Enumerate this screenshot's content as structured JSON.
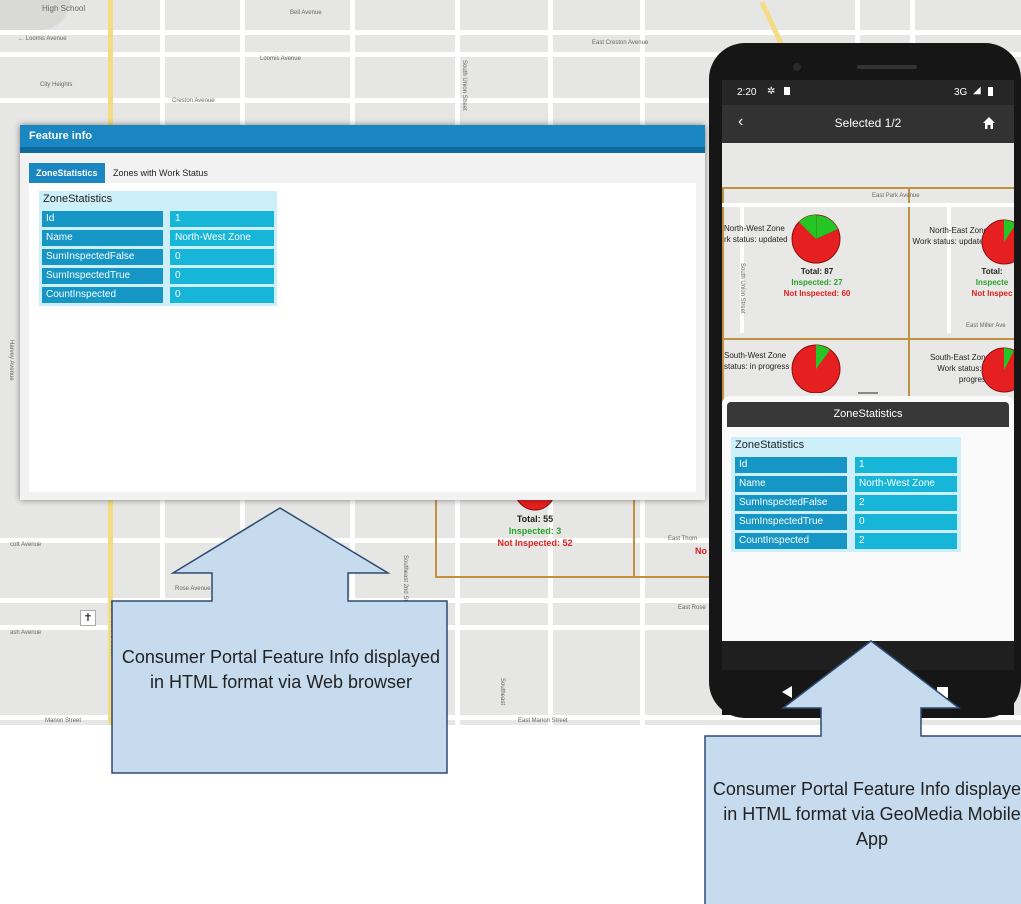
{
  "map": {
    "streets": {
      "loomis_avenue_w": "← Loomis Avenue",
      "bell_avenue": "Bell Avenue",
      "loomis_avenue": "Loomis Avenue",
      "east_creston_avenue": "East Creston Avenue",
      "city_heights": "City Heights",
      "creston_avenue": "Creston Avenue",
      "high_school": "High School",
      "south_union_street": "South Union Street",
      "rose_avenue": "Rose Avenue",
      "east_rose": "East Rose",
      "manon_street": "Manon Street",
      "east_manon_street": "East Manon Street",
      "east_thorn": "East Thorn",
      "cott_avenue": "cott Avenue",
      "ash_avenue": "ash Avenue",
      "southeast_2nd_street": "Southeast 2nd Street",
      "southwest_3rd_street": "Southwest 3rd Street",
      "southeast": "Southeast",
      "harvey_avenue": "Harvey Avenue"
    },
    "zone_label": {
      "total": "Total: 55",
      "inspected": "Inspected: 3",
      "not_inspected": "Not Inspected: 52",
      "clipped_no": "No"
    }
  },
  "dialog": {
    "title": "Feature info",
    "tabs": [
      "ZoneStatistics",
      "Zones with Work Status"
    ],
    "zone_statistics": {
      "heading": "ZoneStatistics",
      "rows": [
        {
          "key": "Id",
          "value": "1"
        },
        {
          "key": "Name",
          "value": "North-West Zone"
        },
        {
          "key": "SumInspectedFalse",
          "value": "0"
        },
        {
          "key": "SumInspectedTrue",
          "value": "0"
        },
        {
          "key": "CountInspected",
          "value": "0"
        }
      ]
    }
  },
  "phone": {
    "status_time": "2:20",
    "status_network": "3G",
    "app_title": "Selected 1/2",
    "map_zones": {
      "nw_title": "North-West Zone",
      "nw_status": "rk status: updated",
      "nw_total": "Total: 87",
      "nw_inspected": "Inspected: 27",
      "nw_not_inspected": "Not Inspected: 60",
      "ne_title": "North-East Zone",
      "ne_status": "Work status: updated",
      "ne_total": "Total:",
      "ne_inspected": "Inspecte",
      "ne_not_inspected": "Not Inspec",
      "sw_title": "South-West Zone",
      "sw_status": "status: in progress",
      "se_title": "South-East Zone",
      "se_status": "Work status: in progress",
      "street_east_park": "East Park Avenue",
      "street_union": "South Union Street",
      "street_east_miller": "East Miller Ave"
    },
    "sheet_title": "ZoneStatistics",
    "zone_statistics": {
      "heading": "ZoneStatistics",
      "rows": [
        {
          "key": "Id",
          "value": "1"
        },
        {
          "key": "Name",
          "value": "North-West Zone"
        },
        {
          "key": "SumInspectedFalse",
          "value": "2"
        },
        {
          "key": "SumInspectedTrue",
          "value": "0"
        },
        {
          "key": "CountInspected",
          "value": "2"
        }
      ]
    }
  },
  "callouts": {
    "web": "Consumer Portal Feature Info displayed in HTML format via Web browser",
    "mobile": "Consumer Portal Feature Info displayed in HTML format via GeoMedia Mobile App"
  },
  "colors": {
    "dialog_header": "#1a87c2",
    "table_key": "#1596c4",
    "table_value": "#17b6d8",
    "callout_fill": "#c6dbee",
    "callout_stroke": "#2f4a74",
    "pie_green": "#26c526",
    "pie_red": "#e62020"
  }
}
